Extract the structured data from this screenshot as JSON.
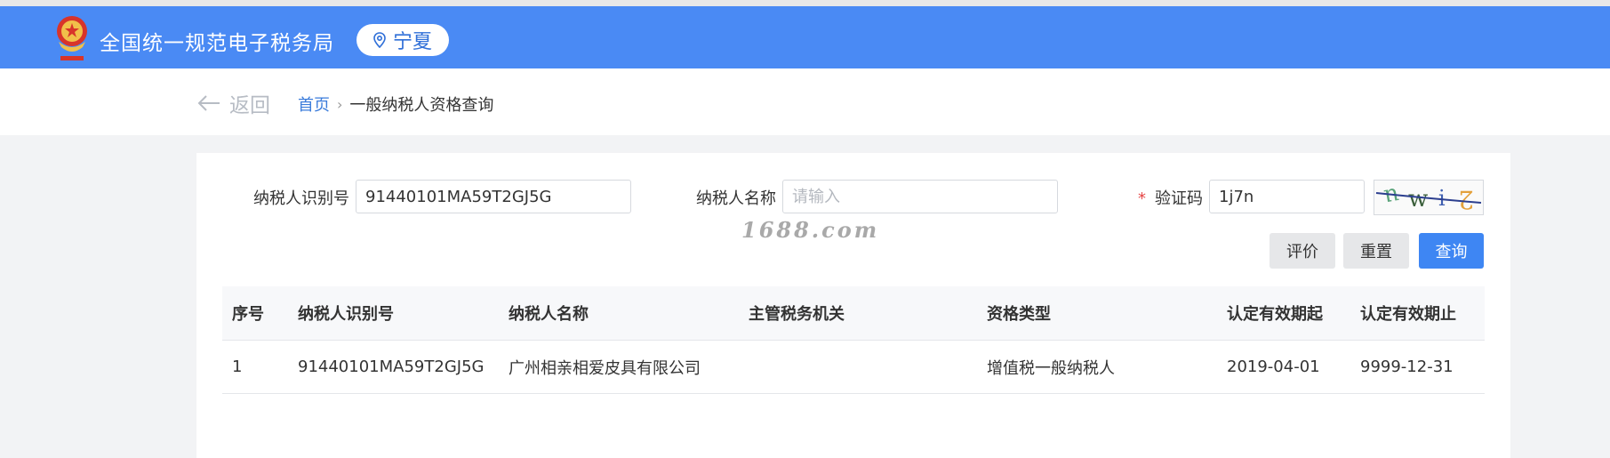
{
  "header": {
    "title": "全国统一规范电子税务局",
    "region": "宁夏",
    "emblem_icon": "tax-emblem-icon",
    "location_icon": "location-pin-icon",
    "color": "#4a8af4"
  },
  "nav": {
    "back_label": "返回",
    "back_icon": "arrow-left-icon",
    "breadcrumb": {
      "home": "首页",
      "separator": "›",
      "current": "一般纳税人资格查询"
    }
  },
  "form": {
    "taxpayer_id_label": "纳税人识别号",
    "taxpayer_id_value": "91440101MA59T2GJ5G",
    "taxpayer_name_label": "纳税人名称",
    "taxpayer_name_placeholder": "请输入",
    "captcha_required_mark": "*",
    "captcha_label": "验证码",
    "captcha_value": "1j7n",
    "captcha_image_text": "uwi2"
  },
  "buttons": {
    "evaluate": "评价",
    "reset": "重置",
    "query": "查询",
    "primary_color": "#3e86f3"
  },
  "watermark": "1688.com",
  "table": {
    "headers": [
      "序号",
      "纳税人识别号",
      "纳税人名称",
      "主管税务机关",
      "资格类型",
      "认定有效期起",
      "认定有效期止"
    ],
    "rows": [
      [
        "1",
        "91440101MA59T2GJ5G",
        "广州相亲相爱皮具有限公司",
        "",
        "增值税一般纳税人",
        "2019-04-01",
        "9999-12-31"
      ]
    ]
  }
}
